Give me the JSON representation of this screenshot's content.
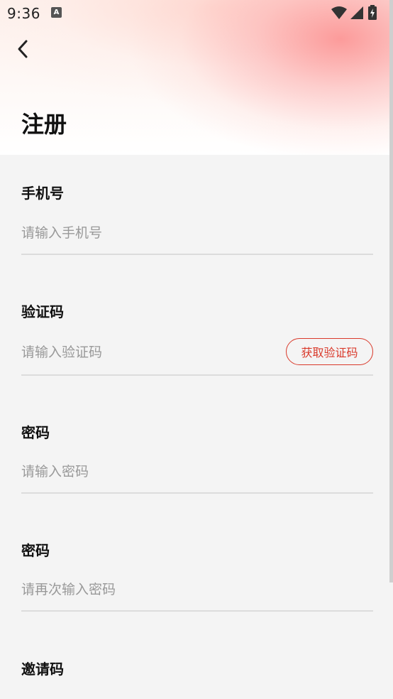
{
  "status_bar": {
    "time": "9:36",
    "notification_icon": "A",
    "icons": [
      "wifi-icon",
      "signal-icon",
      "battery-charging-icon"
    ]
  },
  "header": {
    "back_icon": "chevron-left-icon",
    "title": "注册"
  },
  "form": {
    "phone": {
      "label": "手机号",
      "placeholder": "请输入手机号",
      "value": ""
    },
    "code": {
      "label": "验证码",
      "placeholder": "请输入验证码",
      "value": "",
      "send_button": "获取验证码"
    },
    "password": {
      "label": "密码",
      "placeholder": "请输入密码",
      "value": ""
    },
    "confirm_password": {
      "label": "密码",
      "placeholder": "请再次输入密码",
      "value": ""
    },
    "invite": {
      "label": "邀请码"
    }
  },
  "colors": {
    "accent": "#d93a2b",
    "background": "#f4f4f4",
    "header_gradient": "#fc8c8c"
  }
}
